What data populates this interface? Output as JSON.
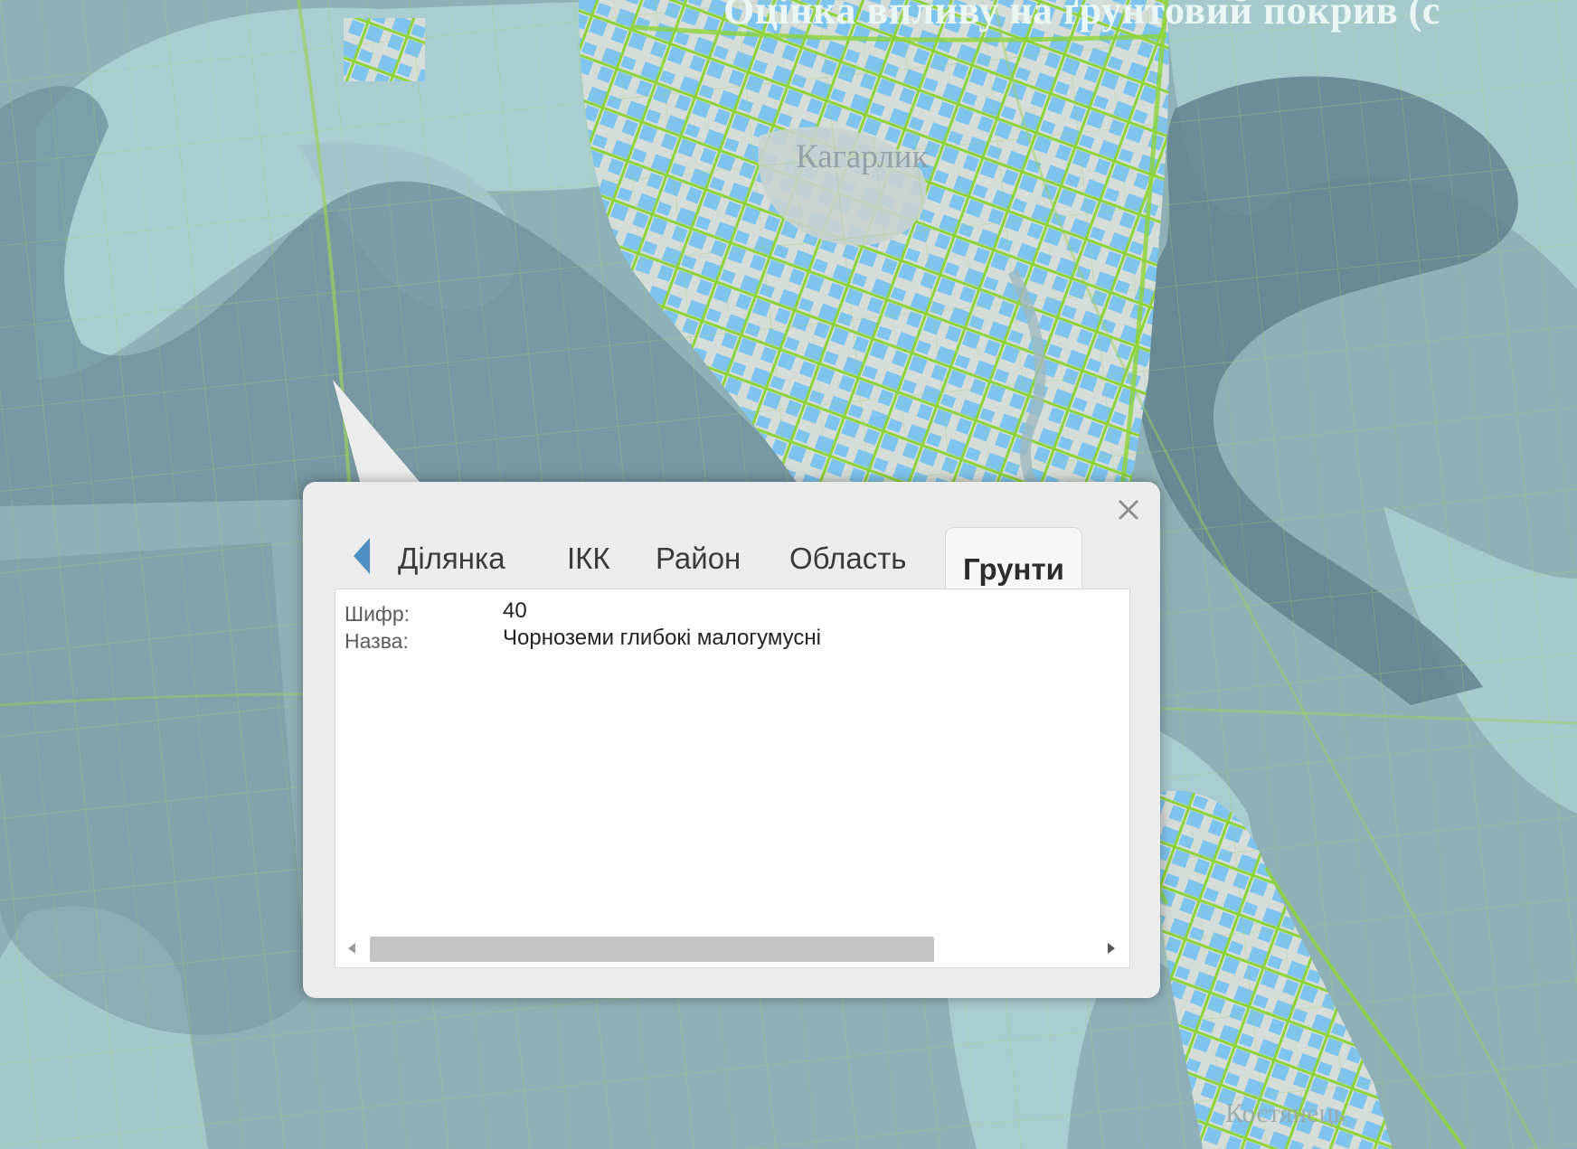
{
  "page": {
    "title": "Оцінка впливу на ґрунтовий покрив (с"
  },
  "map": {
    "labels": {
      "top": "Кагарлик",
      "bottom": "Костянець"
    },
    "colors": {
      "water": "#8fb0b6",
      "soil_dark": "#6f8f9b",
      "soil_light": "#a9cdd1",
      "urban_blue": "#7ec4ee",
      "roads": "#8dd33a",
      "urban_bg": "#d7dcd9"
    }
  },
  "popup": {
    "close_icon": "close-icon",
    "back_icon": "chevron-left-icon",
    "tabs": [
      {
        "label": "Ділянка",
        "active": false
      },
      {
        "label": "ІКК",
        "active": false
      },
      {
        "label": "Район",
        "active": false
      },
      {
        "label": "Область",
        "active": false
      },
      {
        "label": "Грунти",
        "active": true
      }
    ],
    "fields": [
      {
        "label": "Шифр:",
        "value": "40"
      },
      {
        "label": "Назва:",
        "value": "Чорноземи глибокі малогумусні"
      }
    ],
    "scrollbar": {
      "position": 0.0,
      "visible_fraction": 0.78
    }
  }
}
